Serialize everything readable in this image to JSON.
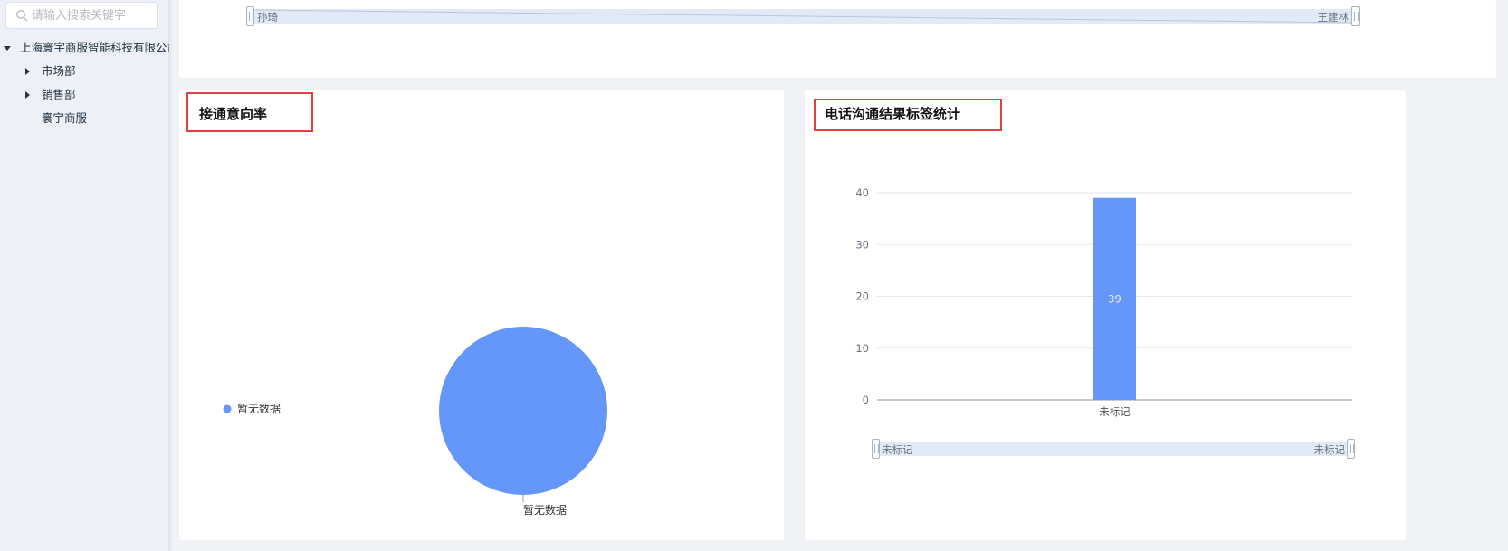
{
  "sidebar": {
    "search_placeholder": "请输入搜索关键字",
    "tree": [
      {
        "label": "上海寰宇商服智能科技有限公司",
        "expanded": true
      },
      {
        "label": "市场部",
        "expanded": false
      },
      {
        "label": "销售部",
        "expanded": false
      },
      {
        "label": "寰宇商服"
      }
    ]
  },
  "top_chart": {
    "slider_start": "孙琦",
    "slider_end": "王建林"
  },
  "intent_card": {
    "title": "接通意向率",
    "chart_data": {
      "type": "pie",
      "legend": [
        "暂无数据"
      ],
      "legend_placement": "left",
      "slices": [
        {
          "name": "暂无数据",
          "value": 1
        }
      ],
      "slice_label": "暂无数据",
      "color": "#6596fa"
    }
  },
  "tag_card": {
    "title": "电话沟通结果标签统计",
    "chart_data": {
      "type": "bar",
      "categories": [
        "未标记"
      ],
      "values": [
        39
      ],
      "ylim": [
        0,
        40
      ],
      "yticks": [
        "0",
        "10",
        "20",
        "30",
        "40"
      ],
      "data_labels": [
        "39"
      ],
      "grid": true,
      "color": "#6596fa"
    },
    "slider_start": "未标记",
    "slider_end": "未标记"
  },
  "colors": {
    "highlight": "#e04040",
    "bar": "#6596fa",
    "slider": "#e2eaf6"
  }
}
